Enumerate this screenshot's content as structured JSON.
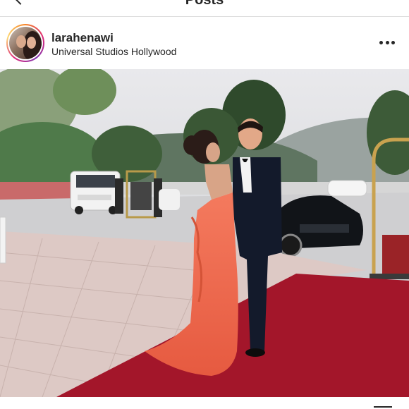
{
  "top_bar": {
    "title": "Posts",
    "back_icon": "chevron-left-icon"
  },
  "post": {
    "username": "larahenawi",
    "location": "Universal Studios Hollywood",
    "more_icon": "more-horizontal-icon"
  },
  "colors": {
    "text": "#262626",
    "divider": "#dbdbdb",
    "avatar_ring": [
      "#f58529",
      "#dd2a7b",
      "#8134af",
      "#feda77"
    ],
    "dress": "#f06a4e",
    "carpet": "#a3162a"
  }
}
